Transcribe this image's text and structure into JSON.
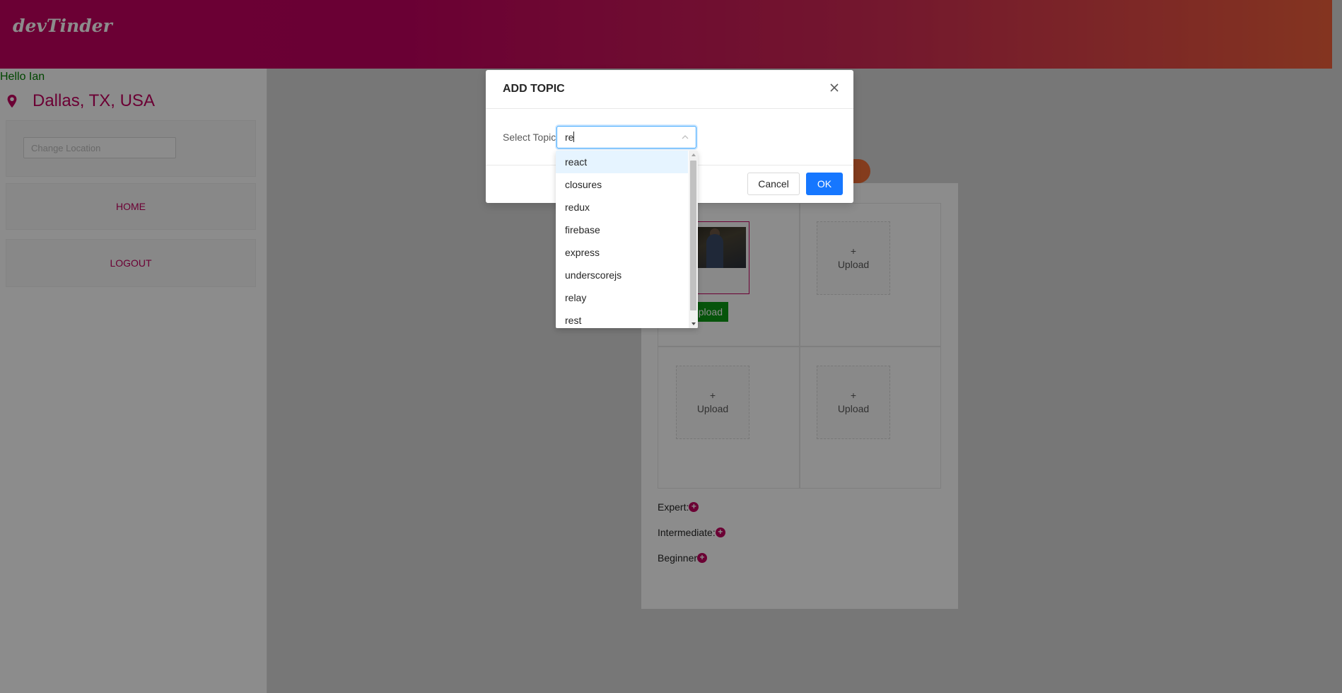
{
  "header": {
    "logo": "devTinder"
  },
  "sidebar": {
    "greeting": "Hello Ian",
    "location": "Dallas, TX, USA",
    "change_location_placeholder": "Change Location",
    "nav": {
      "home": "HOME",
      "logout": "LOGOUT"
    }
  },
  "profile": {
    "upload_label": "Upload",
    "upload_plus": "+",
    "upload_button": "Upload",
    "skills": {
      "expert": "Expert:",
      "intermediate": "Intermediate:",
      "beginner": "Beginner"
    }
  },
  "modal": {
    "title": "ADD TOPIC",
    "select_label": "Select Topic",
    "select_value": "re",
    "cancel": "Cancel",
    "ok": "OK",
    "options": [
      "react",
      "closures",
      "redux",
      "firebase",
      "express",
      "underscorejs",
      "relay",
      "rest"
    ],
    "active_option": "react"
  },
  "colors": {
    "brand": "#c4005f",
    "primary": "#1677ff",
    "success": "#0c9a14"
  }
}
